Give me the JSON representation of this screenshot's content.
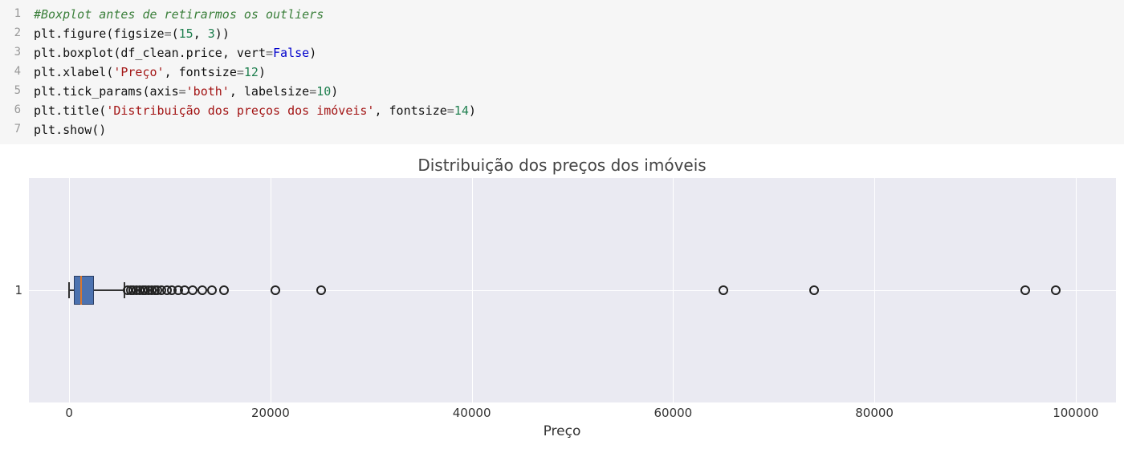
{
  "code": {
    "lines": [
      {
        "n": "1",
        "tokens": [
          {
            "t": "#Boxplot antes de retirarmos os outliers",
            "c": "c-comment"
          }
        ]
      },
      {
        "n": "2",
        "tokens": [
          {
            "t": "plt",
            "c": "c-ident"
          },
          {
            "t": ".",
            "c": "c-punct"
          },
          {
            "t": "figure",
            "c": "c-func"
          },
          {
            "t": "(",
            "c": "c-paren"
          },
          {
            "t": "figsize",
            "c": "c-arg"
          },
          {
            "t": "=",
            "c": "c-eq"
          },
          {
            "t": "(",
            "c": "c-paren"
          },
          {
            "t": "15",
            "c": "c-num"
          },
          {
            "t": ", ",
            "c": "c-punct"
          },
          {
            "t": "3",
            "c": "c-num"
          },
          {
            "t": ")",
            "c": "c-paren"
          },
          {
            "t": ")",
            "c": "c-paren"
          }
        ]
      },
      {
        "n": "3",
        "tokens": [
          {
            "t": "plt",
            "c": "c-ident"
          },
          {
            "t": ".",
            "c": "c-punct"
          },
          {
            "t": "boxplot",
            "c": "c-func"
          },
          {
            "t": "(",
            "c": "c-paren"
          },
          {
            "t": "df_clean",
            "c": "c-ident"
          },
          {
            "t": ".",
            "c": "c-punct"
          },
          {
            "t": "price",
            "c": "c-ident"
          },
          {
            "t": ", ",
            "c": "c-punct"
          },
          {
            "t": "vert",
            "c": "c-arg"
          },
          {
            "t": "=",
            "c": "c-eq"
          },
          {
            "t": "False",
            "c": "c-kw"
          },
          {
            "t": ")",
            "c": "c-paren"
          }
        ]
      },
      {
        "n": "4",
        "tokens": [
          {
            "t": "plt",
            "c": "c-ident"
          },
          {
            "t": ".",
            "c": "c-punct"
          },
          {
            "t": "xlabel",
            "c": "c-func"
          },
          {
            "t": "(",
            "c": "c-paren"
          },
          {
            "t": "'Preço'",
            "c": "c-str"
          },
          {
            "t": ", ",
            "c": "c-punct"
          },
          {
            "t": "fontsize",
            "c": "c-arg"
          },
          {
            "t": "=",
            "c": "c-eq"
          },
          {
            "t": "12",
            "c": "c-num"
          },
          {
            "t": ")",
            "c": "c-paren"
          }
        ]
      },
      {
        "n": "5",
        "tokens": [
          {
            "t": "plt",
            "c": "c-ident"
          },
          {
            "t": ".",
            "c": "c-punct"
          },
          {
            "t": "tick_params",
            "c": "c-func"
          },
          {
            "t": "(",
            "c": "c-paren"
          },
          {
            "t": "axis",
            "c": "c-arg"
          },
          {
            "t": "=",
            "c": "c-eq"
          },
          {
            "t": "'both'",
            "c": "c-str"
          },
          {
            "t": ", ",
            "c": "c-punct"
          },
          {
            "t": "labelsize",
            "c": "c-arg"
          },
          {
            "t": "=",
            "c": "c-eq"
          },
          {
            "t": "10",
            "c": "c-num"
          },
          {
            "t": ")",
            "c": "c-paren"
          }
        ]
      },
      {
        "n": "6",
        "tokens": [
          {
            "t": "plt",
            "c": "c-ident"
          },
          {
            "t": ".",
            "c": "c-punct"
          },
          {
            "t": "title",
            "c": "c-func"
          },
          {
            "t": "(",
            "c": "c-paren"
          },
          {
            "t": "'Distribuição dos preços dos imóveis'",
            "c": "c-str"
          },
          {
            "t": ", ",
            "c": "c-punct"
          },
          {
            "t": "fontsize",
            "c": "c-arg"
          },
          {
            "t": "=",
            "c": "c-eq"
          },
          {
            "t": "14",
            "c": "c-num"
          },
          {
            "t": ")",
            "c": "c-paren"
          }
        ]
      },
      {
        "n": "7",
        "tokens": [
          {
            "t": "plt",
            "c": "c-ident"
          },
          {
            "t": ".",
            "c": "c-punct"
          },
          {
            "t": "show",
            "c": "c-func"
          },
          {
            "t": "(",
            "c": "c-paren"
          },
          {
            "t": ")",
            "c": "c-paren"
          }
        ]
      }
    ]
  },
  "chart_data": {
    "type": "boxplot",
    "orientation": "horizontal",
    "title": "Distribuição dos preços dos imóveis",
    "xlabel": "Preço",
    "ylabel": "",
    "y_categories": [
      "1"
    ],
    "x_ticks": [
      0,
      20000,
      40000,
      60000,
      80000,
      100000
    ],
    "xlim": [
      -4000,
      104000
    ],
    "box": {
      "q1": 500,
      "median": 1200,
      "q3": 2500,
      "whisker_low": 0,
      "whisker_high": 5500
    },
    "outliers": [
      5800,
      6100,
      6400,
      6700,
      7000,
      7300,
      7600,
      7900,
      8200,
      8500,
      8800,
      9200,
      9700,
      10200,
      10800,
      11500,
      12300,
      13200,
      14200,
      15400,
      20500,
      25000,
      65000,
      74000,
      95000,
      98000
    ]
  }
}
